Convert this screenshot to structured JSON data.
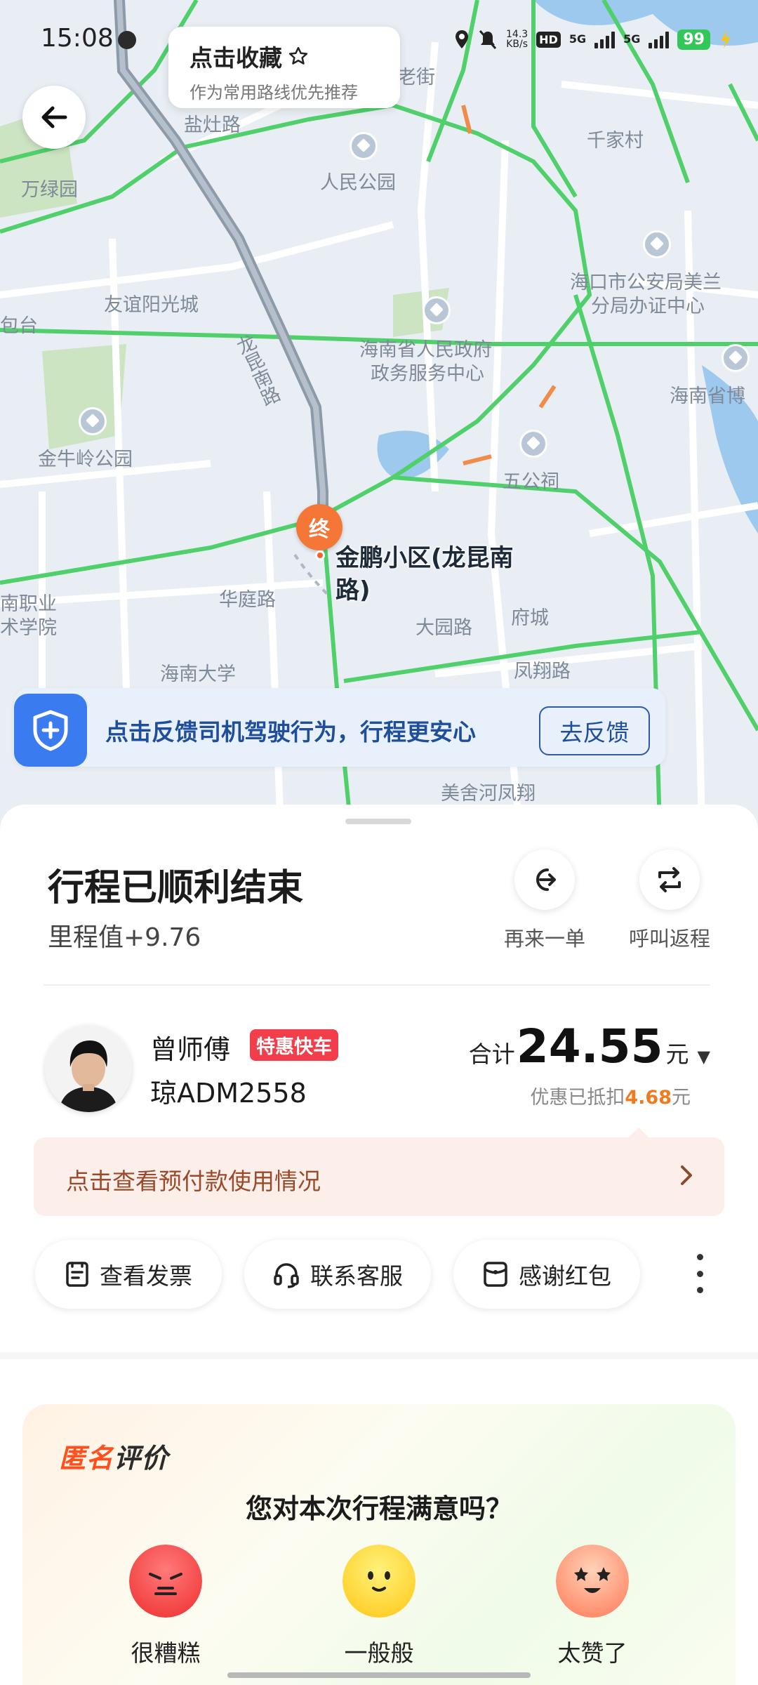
{
  "status_bar": {
    "time": "15:08",
    "net_speed_value": "14.3",
    "net_speed_unit": "KB/s",
    "hd_label": "HD",
    "sim1_tag": "5G",
    "sim2_tag": "5G",
    "battery": "99"
  },
  "favorite_tip": {
    "title": "点击收藏",
    "subtitle": "作为常用路线优先推荐"
  },
  "map": {
    "labels": [
      "盐灶路",
      "万绿园",
      "人民公园",
      "千家村",
      "友谊阳光城",
      "海口市公安局美兰",
      "分局办证中心",
      "海南省人民政府",
      "政务服务中心",
      "海南省博",
      "金牛岭公园",
      "五公祠",
      "华庭路",
      "大园路",
      "府城",
      "凤翔路",
      "海南大学",
      "美舍河凤翔",
      "龙昆南路",
      "包台",
      "老街",
      "南职业",
      "术学院"
    ],
    "destination_marker": "终",
    "destination_name": "金鹏小区(龙昆南路)"
  },
  "safety_banner": {
    "text": "点击反馈司机驾驶行为，行程更安心",
    "button": "去反馈"
  },
  "trip": {
    "title": "行程已顺利结束",
    "mileage": "里程值+9.76",
    "actions": [
      {
        "label": "再来一单",
        "icon": "reorder-arrow-icon"
      },
      {
        "label": "呼叫返程",
        "icon": "return-trip-icon"
      }
    ]
  },
  "driver": {
    "name": "曾师傅",
    "badge": "特惠快车",
    "plate": "琼ADM2558"
  },
  "fare": {
    "prefix": "合计",
    "amount": "24.55",
    "unit": "元",
    "discount_prefix": "优惠已抵扣",
    "discount_value": "4.68",
    "discount_unit": "元"
  },
  "prepay": {
    "text": "点击查看预付款使用情况"
  },
  "pills": [
    {
      "label": "查看发票",
      "icon": "invoice-icon"
    },
    {
      "label": "联系客服",
      "icon": "headset-icon"
    },
    {
      "label": "感谢红包",
      "icon": "red-packet-icon"
    }
  ],
  "rating": {
    "title_a": "匿名",
    "title_b": "评价",
    "question": "您对本次行程满意吗？",
    "options": [
      {
        "label": "很糟糕",
        "color": "#f23d3d"
      },
      {
        "label": "一般般",
        "color": "#ffcf2a"
      },
      {
        "label": "太赞了",
        "color": "#ff8b6a"
      }
    ]
  },
  "colors": {
    "accent_blue": "#3a7bf0",
    "destination_orange": "#f47738",
    "badge_red": "#f23d4a",
    "discount_orange": "#f07a1d",
    "road_green": "#4fd06a"
  }
}
